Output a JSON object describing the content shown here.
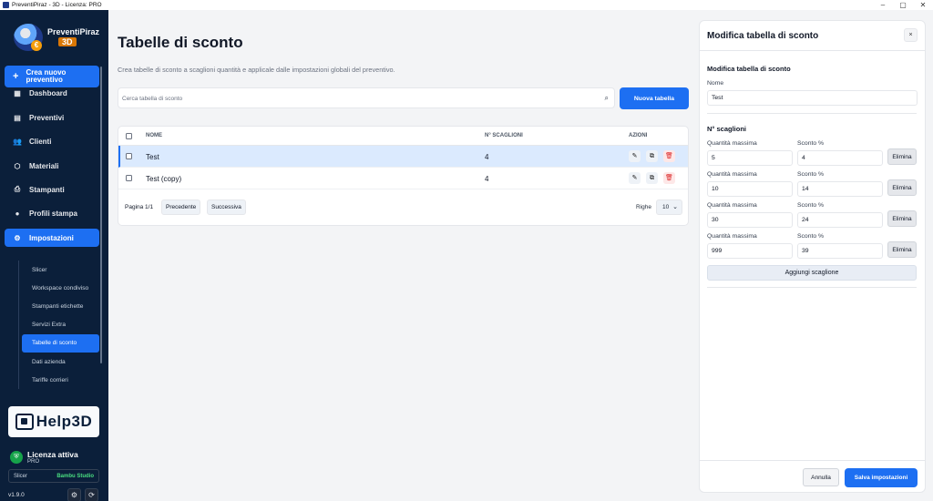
{
  "window": {
    "title": "PreventiPiraz - 3D - Licenza: PRO",
    "minimize": "–",
    "maximize": "▢",
    "close": "✕"
  },
  "sidebar": {
    "logo_text_1": "PreventiPiraz",
    "logo_text_2": "3D",
    "logo_badge": "€",
    "new_quote_label": "Crea nuovo preventivo",
    "nav": [
      {
        "label": "Dashboard",
        "icon": "dashboard-icon"
      },
      {
        "label": "Preventivi",
        "icon": "document-icon"
      },
      {
        "label": "Clienti",
        "icon": "users-icon"
      },
      {
        "label": "Materiali",
        "icon": "cube-icon"
      },
      {
        "label": "Stampanti",
        "icon": "printer-icon"
      },
      {
        "label": "Profili stampa",
        "icon": "user-icon"
      },
      {
        "label": "Impostazioni",
        "icon": "gear-icon"
      }
    ],
    "subnav": [
      {
        "label": "Slicer"
      },
      {
        "label": "Workspace condiviso"
      },
      {
        "label": "Stampanti etichette"
      },
      {
        "label": "Servizi Extra"
      },
      {
        "label": "Tabelle di sconto"
      },
      {
        "label": "Dati azienda"
      },
      {
        "label": "Tariffe corrieri"
      }
    ],
    "help_label": "Help3D",
    "license_title": "Licenza attiva",
    "license_sub": "PRO",
    "slicer_label": "Slicer",
    "slicer_value": "Bambu Studio",
    "version": "v1.9.0"
  },
  "main": {
    "title": "Tabelle di sconto",
    "subtitle": "Crea tabelle di sconto a scaglioni quantità e applicale dalle impostazioni globali del preventivo.",
    "search_placeholder": "Cerca tabella di sconto",
    "new_table_label": "Nuova tabella",
    "table": {
      "headers": {
        "name": "NOME",
        "tiers": "N° SCAGLIONI",
        "actions": "AZIONI"
      },
      "rows": [
        {
          "name": "Test",
          "tiers": "4"
        },
        {
          "name": "Test (copy)",
          "tiers": "4"
        }
      ]
    },
    "pager": {
      "page_label": "Pagina 1/1",
      "prev": "Precedente",
      "next": "Successiva",
      "rows_label": "Righe",
      "rows_value": "10"
    }
  },
  "panel": {
    "title": "Modifica tabella di sconto",
    "close": "×",
    "section_title": "Modifica tabella di sconto",
    "name_label": "Nome",
    "name_value": "Test",
    "tiers_title": "N° scaglioni",
    "qty_label": "Quantità massima",
    "disc_label": "Sconto %",
    "delete_label": "Elimina",
    "tiers": [
      {
        "qty": "5",
        "discount": "4"
      },
      {
        "qty": "10",
        "discount": "14"
      },
      {
        "qty": "30",
        "discount": "24"
      },
      {
        "qty": "999",
        "discount": "39"
      }
    ],
    "add_tier_label": "Aggiungi scaglione",
    "cancel_label": "Annulla",
    "save_label": "Salva impostazioni"
  },
  "colors": {
    "sidebar_bg": "#0b1f3a",
    "accent": "#1d6ff2",
    "selected_row": "#dbeafe",
    "danger": "#dc2626",
    "license_green": "#16a34a"
  }
}
